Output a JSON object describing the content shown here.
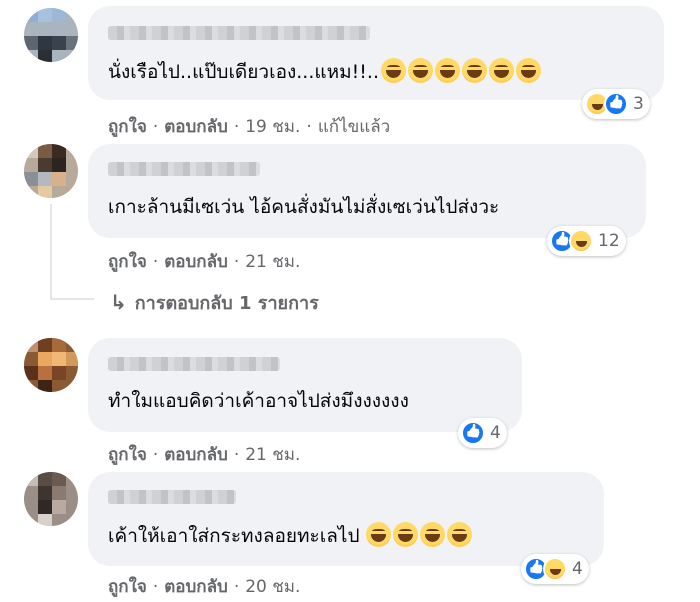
{
  "comments": [
    {
      "text": "นั่งเรือไป..แป๊บเดียวเอง...แหม!!..",
      "emoji_count": 6,
      "reaction_count": "3",
      "actions": {
        "like": "ถูกใจ",
        "reply": "ตอบกลับ",
        "time": "19 ชม.",
        "edited": "แก้ไขแล้ว"
      }
    },
    {
      "text": "เกาะล้านมีเซเว่น ไอ้คนสั่งมันไม่สั่งเซเว่นไปส่งวะ",
      "reaction_count": "12",
      "actions": {
        "like": "ถูกใจ",
        "reply": "ตอบกลับ",
        "time": "21 ชม."
      },
      "replies_label": "การตอบกลับ 1 รายการ"
    },
    {
      "text": "ทำใมแอบคิดว่าเค้าอาจไปส่งมึงงงงงง",
      "reaction_count": "4",
      "actions": {
        "like": "ถูกใจ",
        "reply": "ตอบกลับ",
        "time": "21 ชม."
      }
    },
    {
      "text": "เค้าให้เอาใส่กระทงลอยทะเลไป",
      "emoji_count": 4,
      "reaction_count": "4",
      "actions": {
        "like": "ถูกใจ",
        "reply": "ตอบกลับ",
        "time": "20 ชม."
      }
    }
  ],
  "separator": "·",
  "icons": {
    "like": "like-reaction-icon",
    "haha": "haha-reaction-icon",
    "reply_arrow": "reply-arrow-icon"
  },
  "colors": {
    "bubble": "#f0f2f5",
    "meta": "#65676b",
    "like_blue": "#1877f2"
  }
}
